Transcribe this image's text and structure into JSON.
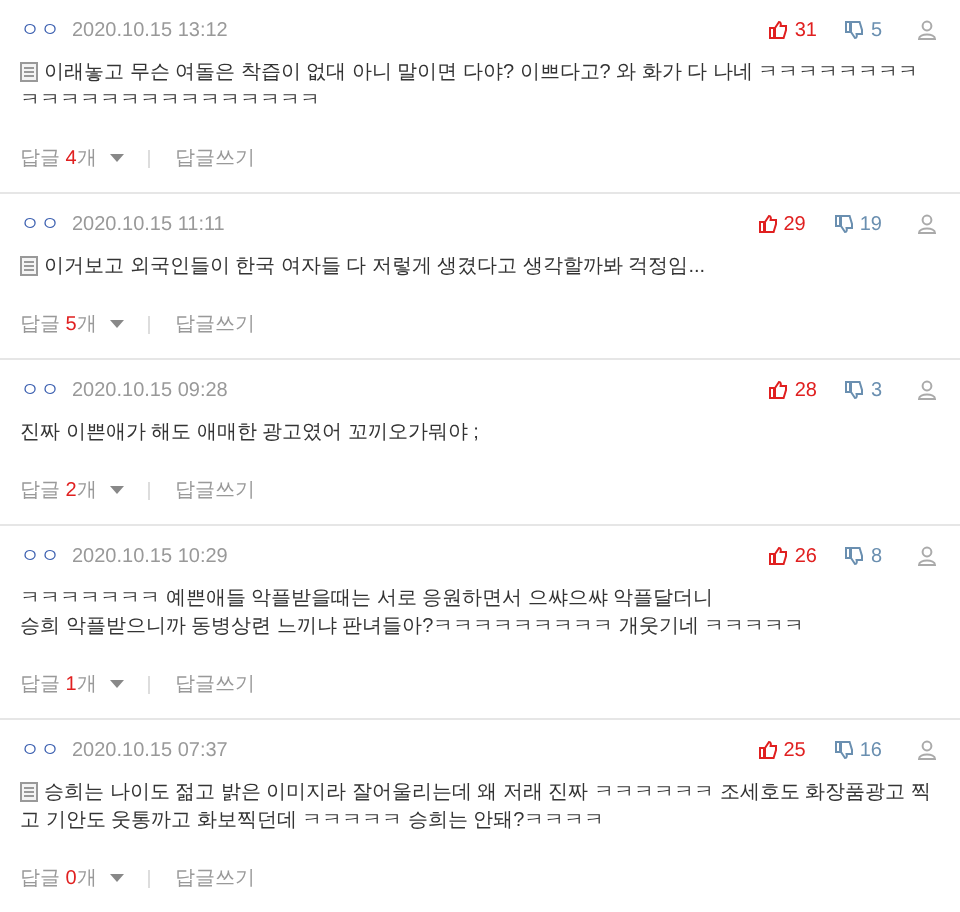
{
  "comments": [
    {
      "author": "ㅇㅇ",
      "date": "2020.10.15 13:12",
      "likes": "31",
      "dislikes": "5",
      "note_icon": true,
      "lines": [
        "이래놓고 무슨 여돌은 착즙이 없대 아니 말이면 다야? 이쁘다고? 와 화가 다 나네 ㅋㅋㅋㅋㅋㅋㅋㅋㅋㅋㅋㅋㅋㅋㅋㅋㅋㅋㅋㅋㅋㅋㅋ"
      ],
      "reply_label": "답글",
      "reply_count": "4",
      "reply_unit": "개",
      "write_reply": "답글쓰기"
    },
    {
      "author": "ㅇㅇ",
      "date": "2020.10.15 11:11",
      "likes": "29",
      "dislikes": "19",
      "note_icon": true,
      "lines": [
        "이거보고 외국인들이 한국 여자들 다 저렇게 생겼다고 생각할까봐 걱정임..."
      ],
      "reply_label": "답글",
      "reply_count": "5",
      "reply_unit": "개",
      "write_reply": "답글쓰기"
    },
    {
      "author": "ㅇㅇ",
      "date": "2020.10.15 09:28",
      "likes": "28",
      "dislikes": "3",
      "note_icon": false,
      "lines": [
        "진짜 이쁜애가 해도 애매한 광고였어 꼬끼오가뭐야 ;"
      ],
      "reply_label": "답글",
      "reply_count": "2",
      "reply_unit": "개",
      "write_reply": "답글쓰기"
    },
    {
      "author": "ㅇㅇ",
      "date": "2020.10.15 10:29",
      "likes": "26",
      "dislikes": "8",
      "note_icon": false,
      "lines": [
        "ㅋㅋㅋㅋㅋㅋㅋ 예쁜애들 악플받을때는 서로 응원하면서 으쌰으쌰 악플달더니",
        "승희 악플받으니까 동병상련 느끼냐 판녀들아?ㅋㅋㅋㅋㅋㅋㅋㅋㅋ 개웃기네 ㅋㅋㅋㅋㅋ"
      ],
      "reply_label": "답글",
      "reply_count": "1",
      "reply_unit": "개",
      "write_reply": "답글쓰기"
    },
    {
      "author": "ㅇㅇ",
      "date": "2020.10.15 07:37",
      "likes": "25",
      "dislikes": "16",
      "note_icon": true,
      "lines": [
        "승희는 나이도 젊고 밝은 이미지라 잘어울리는데 왜 저래 진짜 ㅋㅋㅋㅋㅋㅋ 조세호도 화장품광고 찍고 기안도 웃통까고 화보찍던데 ㅋㅋㅋㅋㅋ 승희는 안돼?ㅋㅋㅋㅋ"
      ],
      "reply_label": "답글",
      "reply_count": "0",
      "reply_unit": "개",
      "write_reply": "답글쓰기"
    }
  ]
}
